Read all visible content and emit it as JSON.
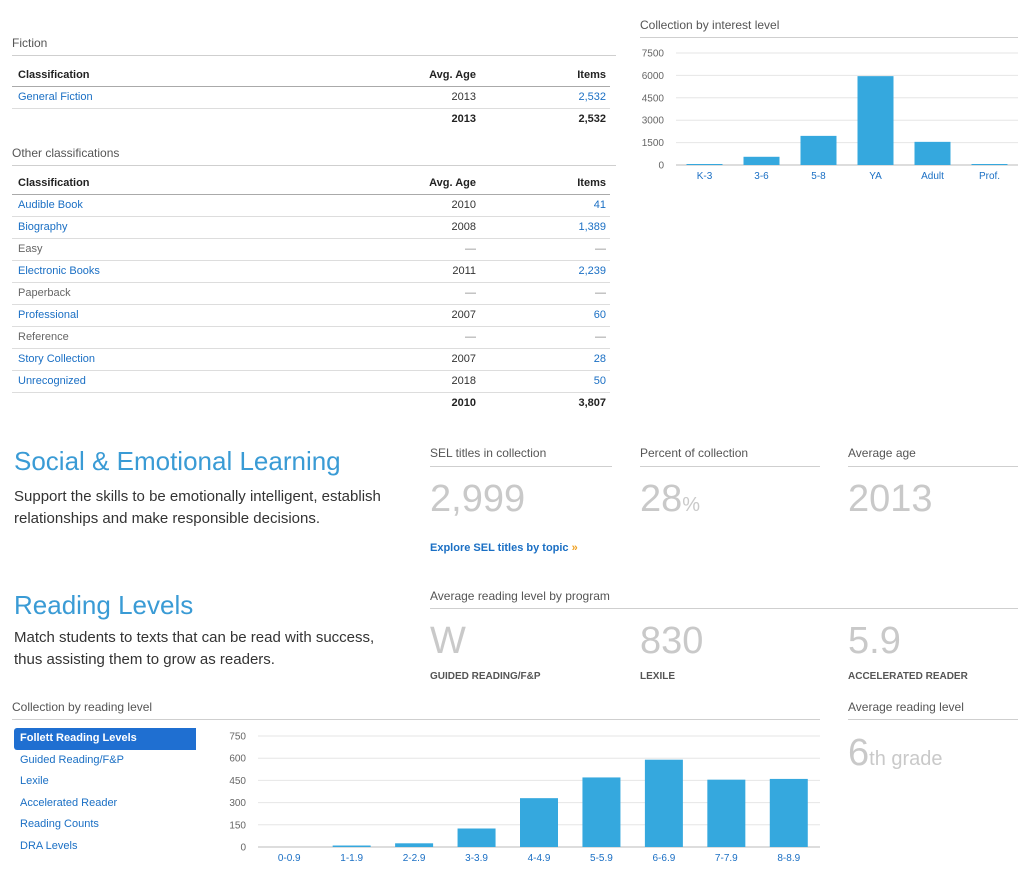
{
  "fiction": {
    "title": "Fiction",
    "headers": {
      "classification": "Classification",
      "avg_age": "Avg. Age",
      "items": "Items"
    },
    "rows": [
      {
        "classification": "General Fiction",
        "avg_age": "2013",
        "items": "2,532"
      }
    ],
    "total": {
      "avg_age": "2013",
      "items": "2,532"
    }
  },
  "other": {
    "title": "Other classifications",
    "headers": {
      "classification": "Classification",
      "avg_age": "Avg. Age",
      "items": "Items"
    },
    "rows": [
      {
        "classification": "Audible Book",
        "avg_age": "2010",
        "items": "41"
      },
      {
        "classification": "Biography",
        "avg_age": "2008",
        "items": "1,389"
      },
      {
        "classification": "Easy",
        "avg_age": "—",
        "items": "—"
      },
      {
        "classification": "Electronic Books",
        "avg_age": "2011",
        "items": "2,239"
      },
      {
        "classification": "Paperback",
        "avg_age": "—",
        "items": "—"
      },
      {
        "classification": "Professional",
        "avg_age": "2007",
        "items": "60"
      },
      {
        "classification": "Reference",
        "avg_age": "—",
        "items": "—"
      },
      {
        "classification": "Story Collection",
        "avg_age": "2007",
        "items": "28"
      },
      {
        "classification": "Unrecognized",
        "avg_age": "2018",
        "items": "50"
      }
    ],
    "total": {
      "avg_age": "2010",
      "items": "3,807"
    }
  },
  "sel": {
    "heading": "Social & Emotional Learning",
    "description": "Support the skills to be emotionally intelligent, establish relationships and make responsible decisions.",
    "stats": [
      {
        "label": "SEL titles in collection",
        "value": "2,999",
        "unit": ""
      },
      {
        "label": "Percent of collection",
        "value": "28",
        "unit": "%"
      },
      {
        "label": "Average age",
        "value": "2013",
        "unit": ""
      }
    ],
    "explore_link": "Explore SEL titles by topic",
    "explore_arrow": "»"
  },
  "reading": {
    "heading": "Reading Levels",
    "description": "Match students to texts that can be read with success, thus assisting them to grow as readers.",
    "program_label": "Average reading level by program",
    "programs": [
      {
        "value": "W",
        "caption": "GUIDED READING/F&P"
      },
      {
        "value": "830",
        "caption": "LEXILE"
      },
      {
        "value": "5.9",
        "caption": "ACCELERATED READER"
      }
    ],
    "collection_label": "Collection by reading level",
    "nav": [
      "Follett Reading Levels",
      "Guided Reading/F&P",
      "Lexile",
      "Accelerated Reader",
      "Reading Counts",
      "DRA Levels"
    ],
    "nav_active": 0,
    "avg_label": "Average reading level",
    "avg_value": "6",
    "avg_suffix": "th grade"
  },
  "colors": {
    "bar": "#35a8de",
    "link": "#1a6fc4",
    "heading": "#3a9bd5",
    "active_nav": "#1f6fd1"
  },
  "chart_data": [
    {
      "type": "bar",
      "title": "Collection by interest level",
      "categories": [
        "K-3",
        "3-6",
        "5-8",
        "YA",
        "Adult",
        "Prof."
      ],
      "values": [
        60,
        550,
        1950,
        5950,
        1550,
        60
      ],
      "yticks": [
        0,
        1500,
        3000,
        4500,
        6000,
        7500
      ],
      "ylim": [
        0,
        7500
      ],
      "grid": true
    },
    {
      "type": "bar",
      "title": "",
      "categories": [
        "0-0.9",
        "1-1.9",
        "2-2.9",
        "3-3.9",
        "4-4.9",
        "5-5.9",
        "6-6.9",
        "7-7.9",
        "8-8.9"
      ],
      "values": [
        0,
        10,
        25,
        125,
        330,
        470,
        590,
        455,
        460
      ],
      "yticks": [
        0,
        150,
        300,
        450,
        600,
        750
      ],
      "ylim": [
        0,
        750
      ],
      "grid": true
    }
  ]
}
